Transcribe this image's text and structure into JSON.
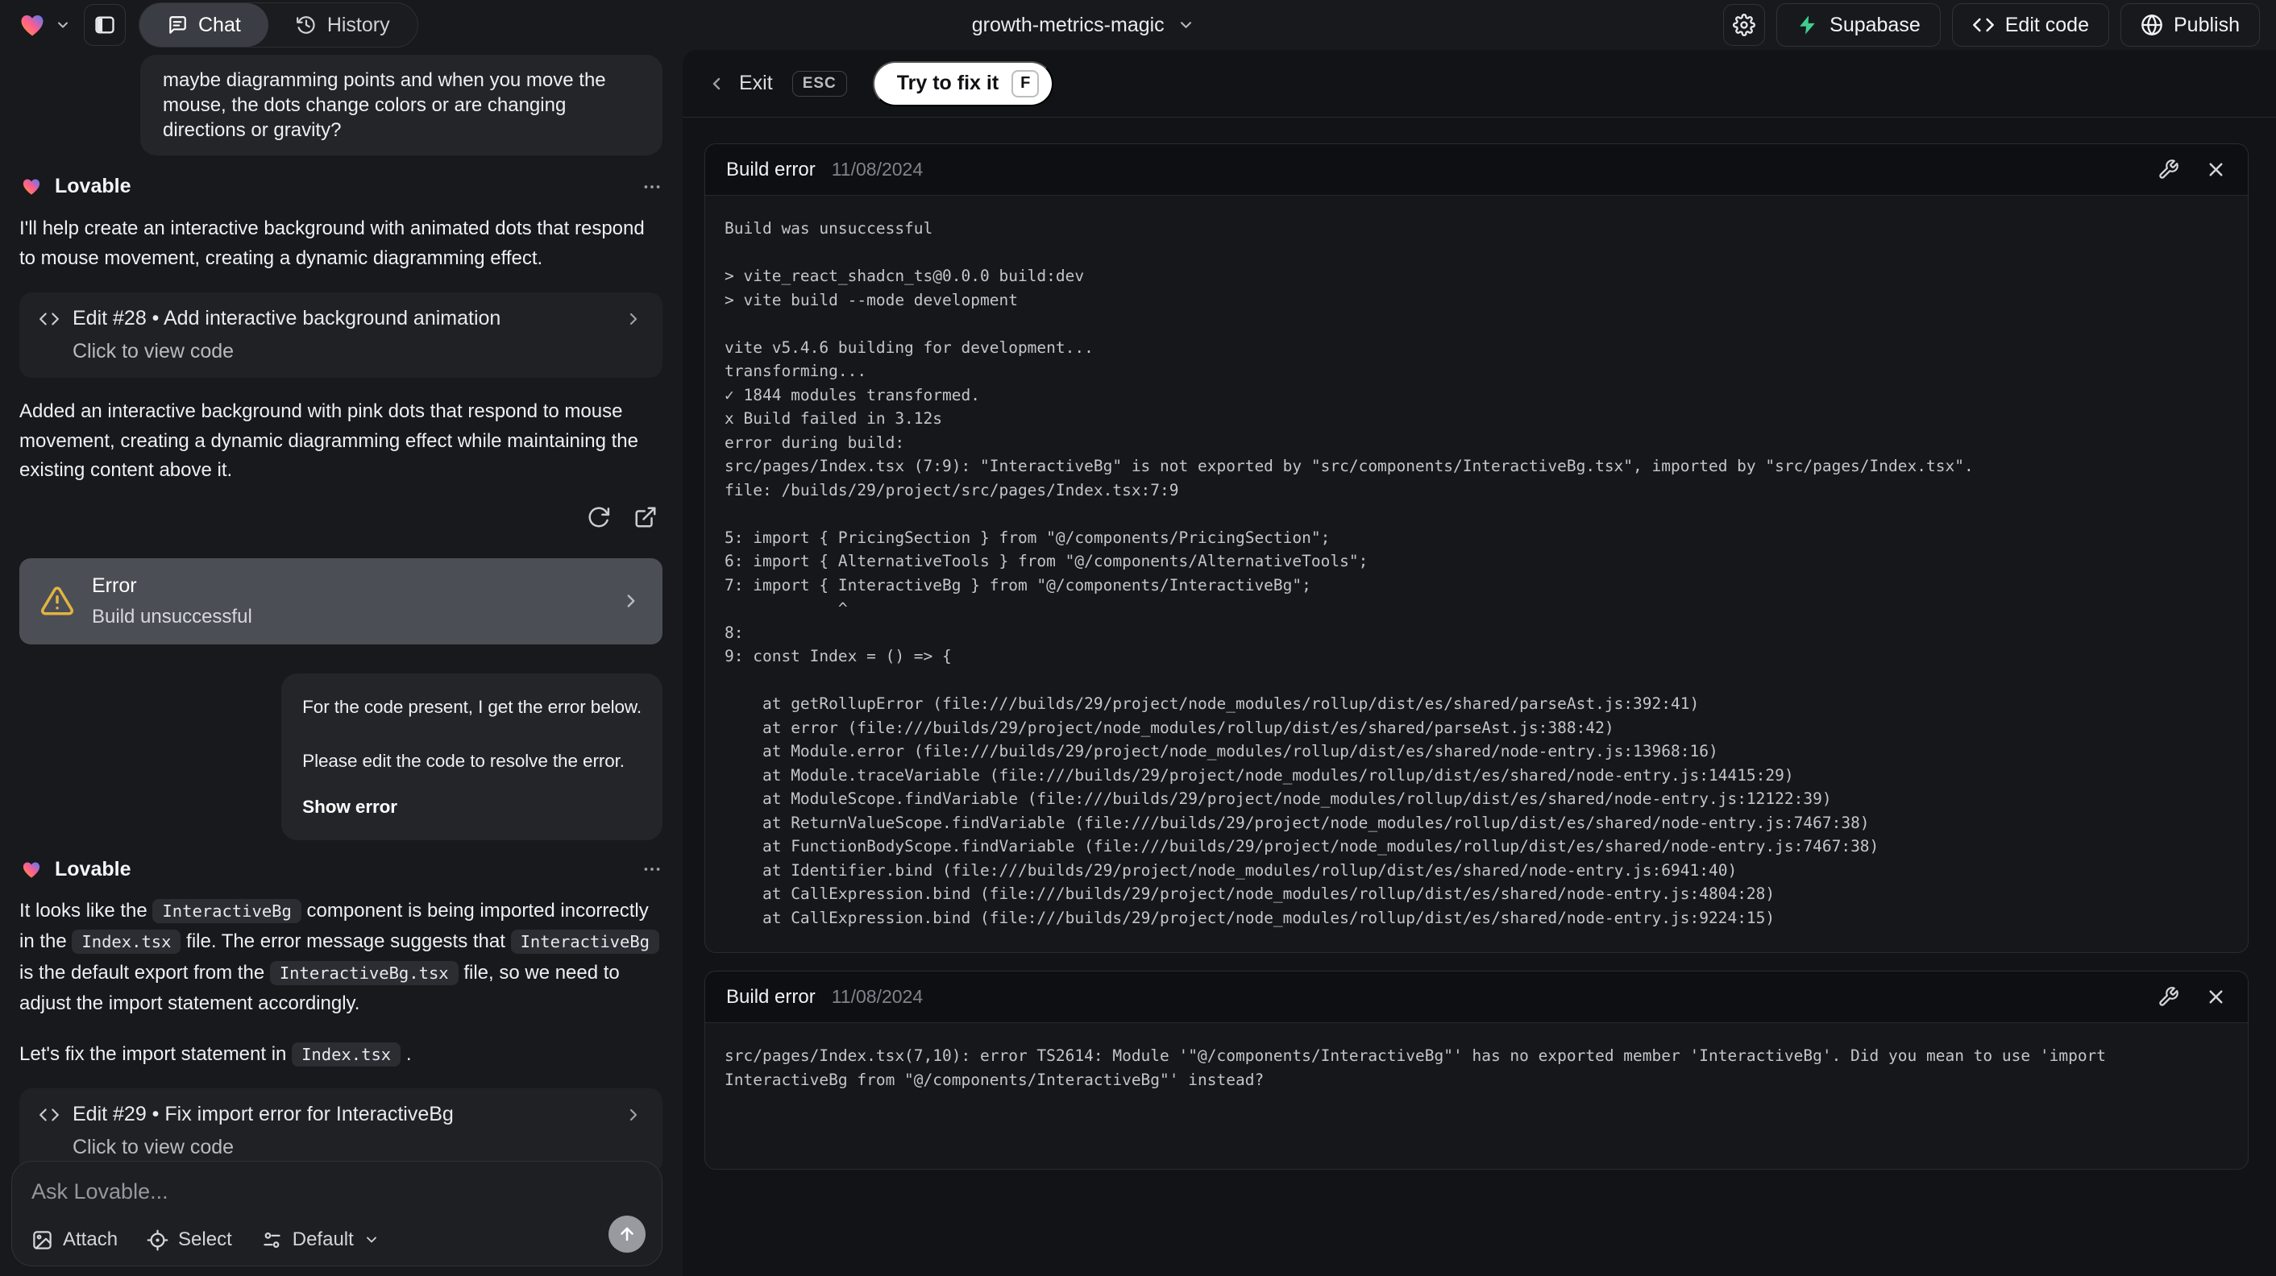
{
  "colors": {
    "warning_amber": "#e3b341",
    "supabase_green": "#3ecf8e",
    "fix_button_bg": "#ffffff",
    "selected_error_card": "#4b4e55"
  },
  "topbar": {
    "project_name": "growth-metrics-magic",
    "tabs": {
      "chat": "Chat",
      "history": "History"
    },
    "actions": {
      "supabase": "Supabase",
      "edit_code": "Edit code",
      "publish": "Publish"
    }
  },
  "chat": {
    "assistant_name": "Lovable",
    "user_message_1": "maybe diagramming points and when you move the mouse, the dots change colors or are changing directions or gravity?",
    "assistant_message_1": "I'll help create an interactive background with animated dots that respond to mouse movement, creating a dynamic diagramming effect.",
    "edit_card_1": {
      "title": "Edit #28 • Add interactive background animation",
      "subtitle": "Click to view code"
    },
    "assistant_message_2": "Added an interactive background with pink dots that respond to mouse movement, creating a dynamic diagramming effect while maintaining the existing content above it.",
    "error_card": {
      "title": "Error",
      "subtitle": "Build unsuccessful"
    },
    "user_message_2": {
      "line1": "For the code present, I get the error below.",
      "line2": "Please edit the code to resolve the error.",
      "action_label": "Show error"
    },
    "assistant_message_3": {
      "p1": [
        {
          "v": "It looks like the "
        },
        {
          "v": "InteractiveBg"
        },
        {
          "v": " component is being imported incorrectly in the "
        },
        {
          "v": "Index.tsx"
        },
        {
          "v": " file. The error message suggests that "
        },
        {
          "v": "InteractiveBg"
        },
        {
          "v": " is the default export from the "
        },
        {
          "v": "InteractiveBg.tsx"
        },
        {
          "v": " file, so we need to adjust the import statement accordingly."
        }
      ],
      "p2": [
        {
          "v": "Let's fix the import statement in "
        },
        {
          "v": "Index.tsx"
        },
        {
          "v": " ."
        }
      ]
    },
    "edit_card_2": {
      "title": "Edit #29 • Fix import error for InteractiveBg",
      "subtitle": "Click to view code"
    }
  },
  "composer": {
    "placeholder": "Ask Lovable...",
    "attach": "Attach",
    "select": "Select",
    "mode": "Default"
  },
  "error_panel": {
    "exit": "Exit",
    "esc": "ESC",
    "fix": "Try to fix it",
    "fix_key": "F",
    "cards": [
      {
        "title": "Build error",
        "date": "11/08/2024",
        "log": "Build was unsuccessful\n\n> vite_react_shadcn_ts@0.0.0 build:dev\n> vite build --mode development\n\nvite v5.4.6 building for development...\ntransforming...\n✓ 1844 modules transformed.\nx Build failed in 3.12s\nerror during build:\nsrc/pages/Index.tsx (7:9): \"InteractiveBg\" is not exported by \"src/components/InteractiveBg.tsx\", imported by \"src/pages/Index.tsx\".\nfile: /builds/29/project/src/pages/Index.tsx:7:9\n\n5: import { PricingSection } from \"@/components/PricingSection\";\n6: import { AlternativeTools } from \"@/components/AlternativeTools\";\n7: import { InteractiveBg } from \"@/components/InteractiveBg\";\n            ^\n8: \n9: const Index = () => {\n\n    at getRollupError (file:///builds/29/project/node_modules/rollup/dist/es/shared/parseAst.js:392:41)\n    at error (file:///builds/29/project/node_modules/rollup/dist/es/shared/parseAst.js:388:42)\n    at Module.error (file:///builds/29/project/node_modules/rollup/dist/es/shared/node-entry.js:13968:16)\n    at Module.traceVariable (file:///builds/29/project/node_modules/rollup/dist/es/shared/node-entry.js:14415:29)\n    at ModuleScope.findVariable (file:///builds/29/project/node_modules/rollup/dist/es/shared/node-entry.js:12122:39)\n    at ReturnValueScope.findVariable (file:///builds/29/project/node_modules/rollup/dist/es/shared/node-entry.js:7467:38)\n    at FunctionBodyScope.findVariable (file:///builds/29/project/node_modules/rollup/dist/es/shared/node-entry.js:7467:38)\n    at Identifier.bind (file:///builds/29/project/node_modules/rollup/dist/es/shared/node-entry.js:6941:40)\n    at CallExpression.bind (file:///builds/29/project/node_modules/rollup/dist/es/shared/node-entry.js:4804:28)\n    at CallExpression.bind (file:///builds/29/project/node_modules/rollup/dist/es/shared/node-entry.js:9224:15)"
      },
      {
        "title": "Build error",
        "date": "11/08/2024",
        "log": "src/pages/Index.tsx(7,10): error TS2614: Module '\"@/components/InteractiveBg\"' has no exported member 'InteractiveBg'. Did you mean to use 'import InteractiveBg from \"@/components/InteractiveBg\"' instead?"
      }
    ]
  }
}
